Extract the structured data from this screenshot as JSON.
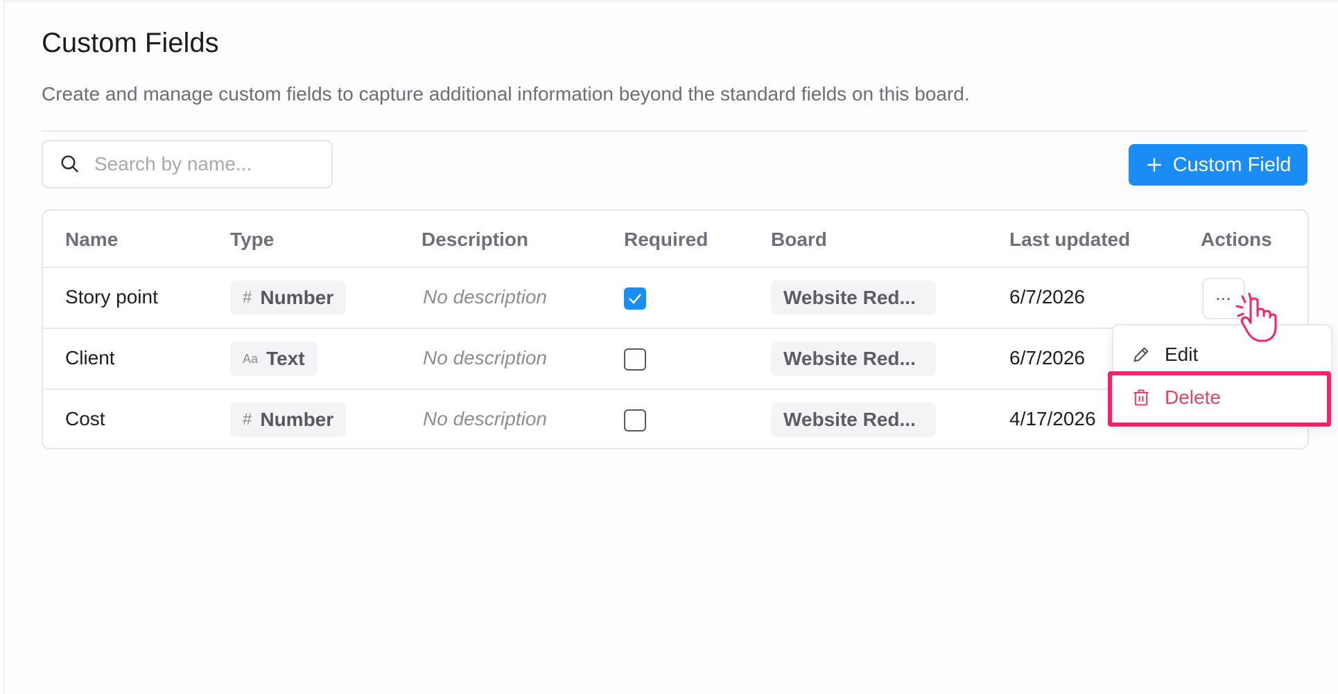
{
  "page": {
    "title": "Custom Fields",
    "subtitle": "Create and manage custom fields to capture additional information beyond the standard fields on this board."
  },
  "search": {
    "placeholder": "Search by name...",
    "value": ""
  },
  "add_button": {
    "label": "Custom Field"
  },
  "table": {
    "headers": {
      "name": "Name",
      "type": "Type",
      "description": "Description",
      "required": "Required",
      "board": "Board",
      "last_updated": "Last updated",
      "actions": "Actions"
    },
    "rows": [
      {
        "name": "Story point",
        "type_icon": "#",
        "type": "Number",
        "description": "No description",
        "required": true,
        "board": "Website Red...",
        "last_updated": "6/7/2026"
      },
      {
        "name": "Client",
        "type_icon": "Aa",
        "type": "Text",
        "description": "No description",
        "required": false,
        "board": "Website Red...",
        "last_updated": "6/7/2026"
      },
      {
        "name": "Cost",
        "type_icon": "#",
        "type": "Number",
        "description": "No description",
        "required": false,
        "board": "Website Red...",
        "last_updated": "4/17/2026"
      }
    ],
    "more_label": "..."
  },
  "menu": {
    "edit": "Edit",
    "delete": "Delete"
  },
  "colors": {
    "accent": "#1a8cf5",
    "danger": "#e0475e",
    "highlight": "#f4236d"
  }
}
